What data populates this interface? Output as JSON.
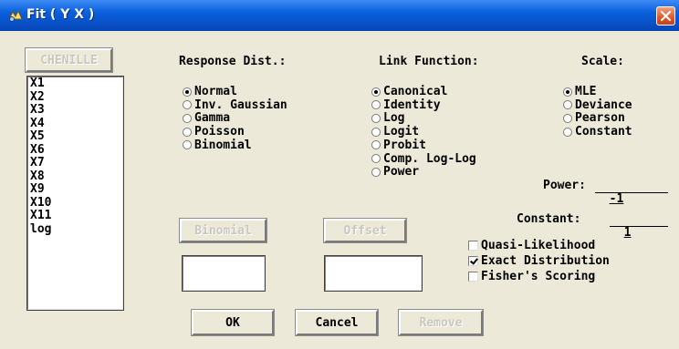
{
  "window": {
    "title": "Fit ( Y X )",
    "app_icon": "sas-app-icon",
    "close_icon": "close-icon",
    "accent": "#0a5fdc",
    "close_color": "#e0562a"
  },
  "chenille_button": "CHENILLE",
  "variables": [
    "X1",
    "X2",
    "X3",
    "X4",
    "X5",
    "X6",
    "X7",
    "X8",
    "X9",
    "X10",
    "X11",
    "log"
  ],
  "response_dist": {
    "heading": "Response Dist.:",
    "options": [
      "Normal",
      "Inv. Gaussian",
      "Gamma",
      "Poisson",
      "Binomial"
    ],
    "selected": "Normal"
  },
  "link_function": {
    "heading": "Link Function:",
    "options": [
      "Canonical",
      "Identity",
      "Log",
      "Logit",
      "Probit",
      "Comp. Log-Log",
      "Power"
    ],
    "selected": "Canonical"
  },
  "scale": {
    "heading": "Scale:",
    "options": [
      "MLE",
      "Deviance",
      "Pearson",
      "Constant"
    ],
    "selected": "MLE"
  },
  "power": {
    "label": "Power:",
    "value": "-1"
  },
  "constant": {
    "label": "Constant:",
    "value": "1"
  },
  "binomial_button": "Binomial",
  "offset_button": "Offset",
  "binomial_field": "",
  "offset_field": "",
  "options": [
    {
      "label": "Quasi-Likelihood",
      "checked": false
    },
    {
      "label": "Exact Distribution",
      "checked": true
    },
    {
      "label": "Fisher's Scoring",
      "checked": false
    }
  ],
  "buttons": {
    "ok": "OK",
    "cancel": "Cancel",
    "remove": "Remove"
  }
}
